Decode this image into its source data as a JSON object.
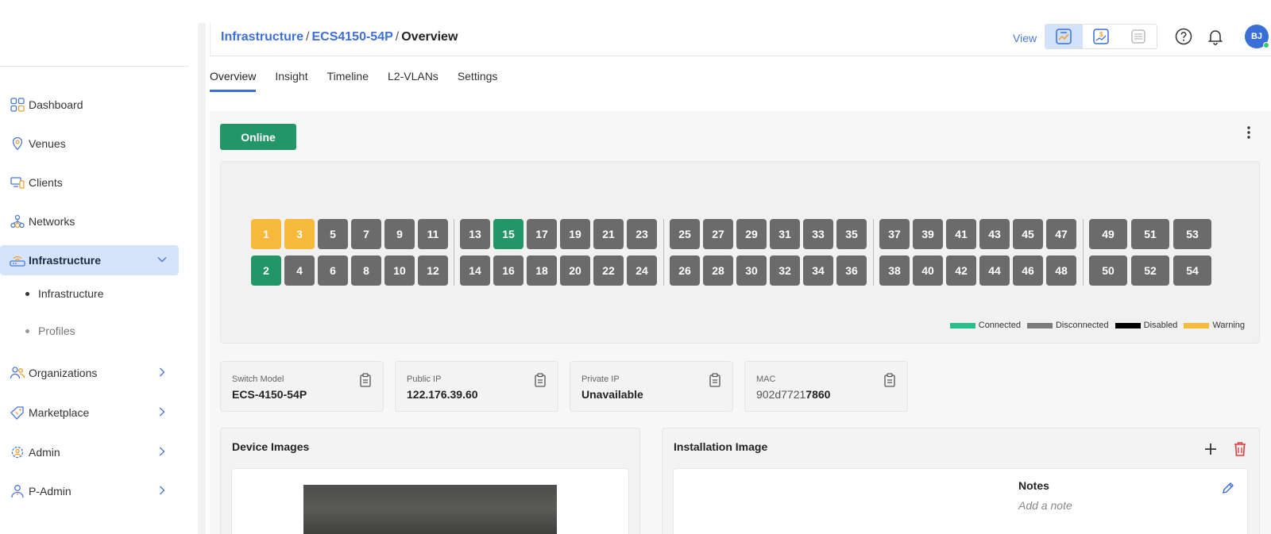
{
  "sidebar": {
    "items": [
      {
        "label": "Dashboard",
        "icon": "dashboard-icon"
      },
      {
        "label": "Venues",
        "icon": "location-pin-icon"
      },
      {
        "label": "Clients",
        "icon": "devices-icon"
      },
      {
        "label": "Networks",
        "icon": "network-icon"
      },
      {
        "label": "Infrastructure",
        "icon": "router-icon",
        "expanded": true
      },
      {
        "label": "Organizations",
        "icon": "users-icon"
      },
      {
        "label": "Marketplace",
        "icon": "tag-icon"
      },
      {
        "label": "Admin",
        "icon": "admin-gear-icon"
      },
      {
        "label": "P-Admin",
        "icon": "person-icon"
      }
    ],
    "subitems": [
      {
        "label": "Infrastructure"
      },
      {
        "label": "Profiles"
      }
    ]
  },
  "header": {
    "breadcrumb": [
      "Infrastructure",
      "ECS4150-54P",
      "Overview"
    ],
    "separator": "/",
    "view_label": "View",
    "avatar_initials": "BJ"
  },
  "tabs": [
    "Overview",
    "Insight",
    "Timeline",
    "L2-VLANs",
    "Settings"
  ],
  "status": {
    "label": "Online",
    "color": "#239667"
  },
  "ports": {
    "top_row": [
      "1",
      "3",
      "5",
      "7",
      "9",
      "11",
      "13",
      "15",
      "17",
      "19",
      "21",
      "23",
      "25",
      "27",
      "29",
      "31",
      "33",
      "35",
      "37",
      "39",
      "41",
      "43",
      "45",
      "47",
      "49",
      "51",
      "53"
    ],
    "bottom_row": [
      "2",
      "4",
      "6",
      "8",
      "10",
      "12",
      "14",
      "16",
      "18",
      "20",
      "22",
      "24",
      "26",
      "28",
      "30",
      "32",
      "34",
      "36",
      "38",
      "40",
      "42",
      "44",
      "46",
      "48",
      "50",
      "52",
      "54"
    ],
    "warning": [
      "1",
      "3"
    ],
    "connected": [
      "15",
      "2"
    ]
  },
  "legend": [
    {
      "label": "Connected",
      "color": "#27c08a"
    },
    {
      "label": "Disconnected",
      "color": "#7a7a7a"
    },
    {
      "label": "Disabled",
      "color": "#000000"
    },
    {
      "label": "Warning",
      "color": "#f7b939"
    }
  ],
  "info": [
    {
      "label": "Switch Model",
      "value": "ECS-4150-54P"
    },
    {
      "label": "Public IP",
      "value": "122.176.39.60"
    },
    {
      "label": "Private IP",
      "value": "Unavailable"
    },
    {
      "label": "MAC",
      "value_prefix": "902d7721",
      "value_suffix": "7860"
    }
  ],
  "device_images": {
    "title": "Device Images"
  },
  "installation": {
    "title": "Installation Image",
    "notes_title": "Notes",
    "notes_placeholder": "Add a note"
  },
  "colors": {
    "accent": "#3a6fd8",
    "online": "#239667",
    "warning": "#f7b939",
    "port_gray": "#6b6b6b",
    "delete_red": "#e03b3b"
  }
}
